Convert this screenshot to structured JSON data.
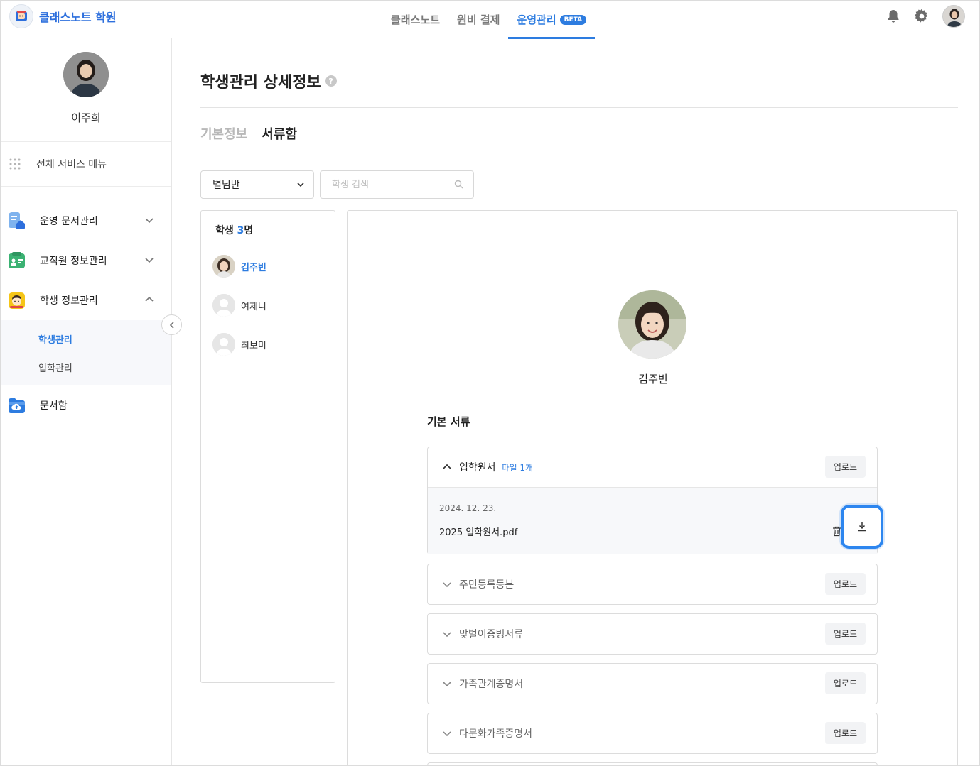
{
  "brand": {
    "name": "클래스노트 학원",
    "logo_icon": "school-logo-icon"
  },
  "topnav": {
    "items": [
      {
        "label": "클래스노트"
      },
      {
        "label": "원비 결제"
      },
      {
        "label": "운영관리",
        "badge": "BETA"
      }
    ],
    "active_index": 2
  },
  "user": {
    "name": "이주희"
  },
  "sidebar": {
    "all_menu_label": "전체 서비스 메뉴",
    "items": [
      {
        "label": "운영 문서관리",
        "icon": "document-house-icon",
        "color": "#4a90e2"
      },
      {
        "label": "교직원 정보관리",
        "icon": "staff-card-icon",
        "color": "#3bb273"
      },
      {
        "label": "학생 정보관리",
        "icon": "student-face-icon",
        "color": "#f5c518"
      },
      {
        "label": "문서함",
        "icon": "folder-cloud-icon",
        "color": "#2d7ce0"
      }
    ],
    "submenu": [
      {
        "label": "학생관리",
        "active": true
      },
      {
        "label": "입학관리",
        "active": false
      }
    ]
  },
  "page": {
    "title": "학생관리 상세정보",
    "tabs": [
      {
        "label": "기본정보",
        "active": false
      },
      {
        "label": "서류함",
        "active": true
      }
    ],
    "class_select": {
      "value": "별님반"
    },
    "search": {
      "placeholder": "학생 검색"
    }
  },
  "students": {
    "title_prefix": "학생 ",
    "count": "3",
    "title_suffix": "명",
    "list": [
      {
        "name": "김주빈",
        "active": true
      },
      {
        "name": "여제니",
        "active": false
      },
      {
        "name": "최보미",
        "active": false
      }
    ]
  },
  "detail": {
    "student_name": "김주빈",
    "section_title": "기본 서류",
    "documents": [
      {
        "title": "입학원서",
        "meta": "파일 1개",
        "upload": "업로드",
        "expanded": true,
        "files": [
          {
            "date": "2024. 12. 23.",
            "name": "2025 입학원서.pdf"
          }
        ]
      },
      {
        "title": "주민등록등본",
        "upload": "업로드",
        "expanded": false
      },
      {
        "title": "맞벌이증빙서류",
        "upload": "업로드",
        "expanded": false
      },
      {
        "title": "가족관계증명서",
        "upload": "업로드",
        "expanded": false
      },
      {
        "title": "다문화가족증명서",
        "upload": "업로드",
        "expanded": false
      }
    ]
  },
  "colors": {
    "accent": "#2d7ce0",
    "highlight": "#2d86ef"
  }
}
